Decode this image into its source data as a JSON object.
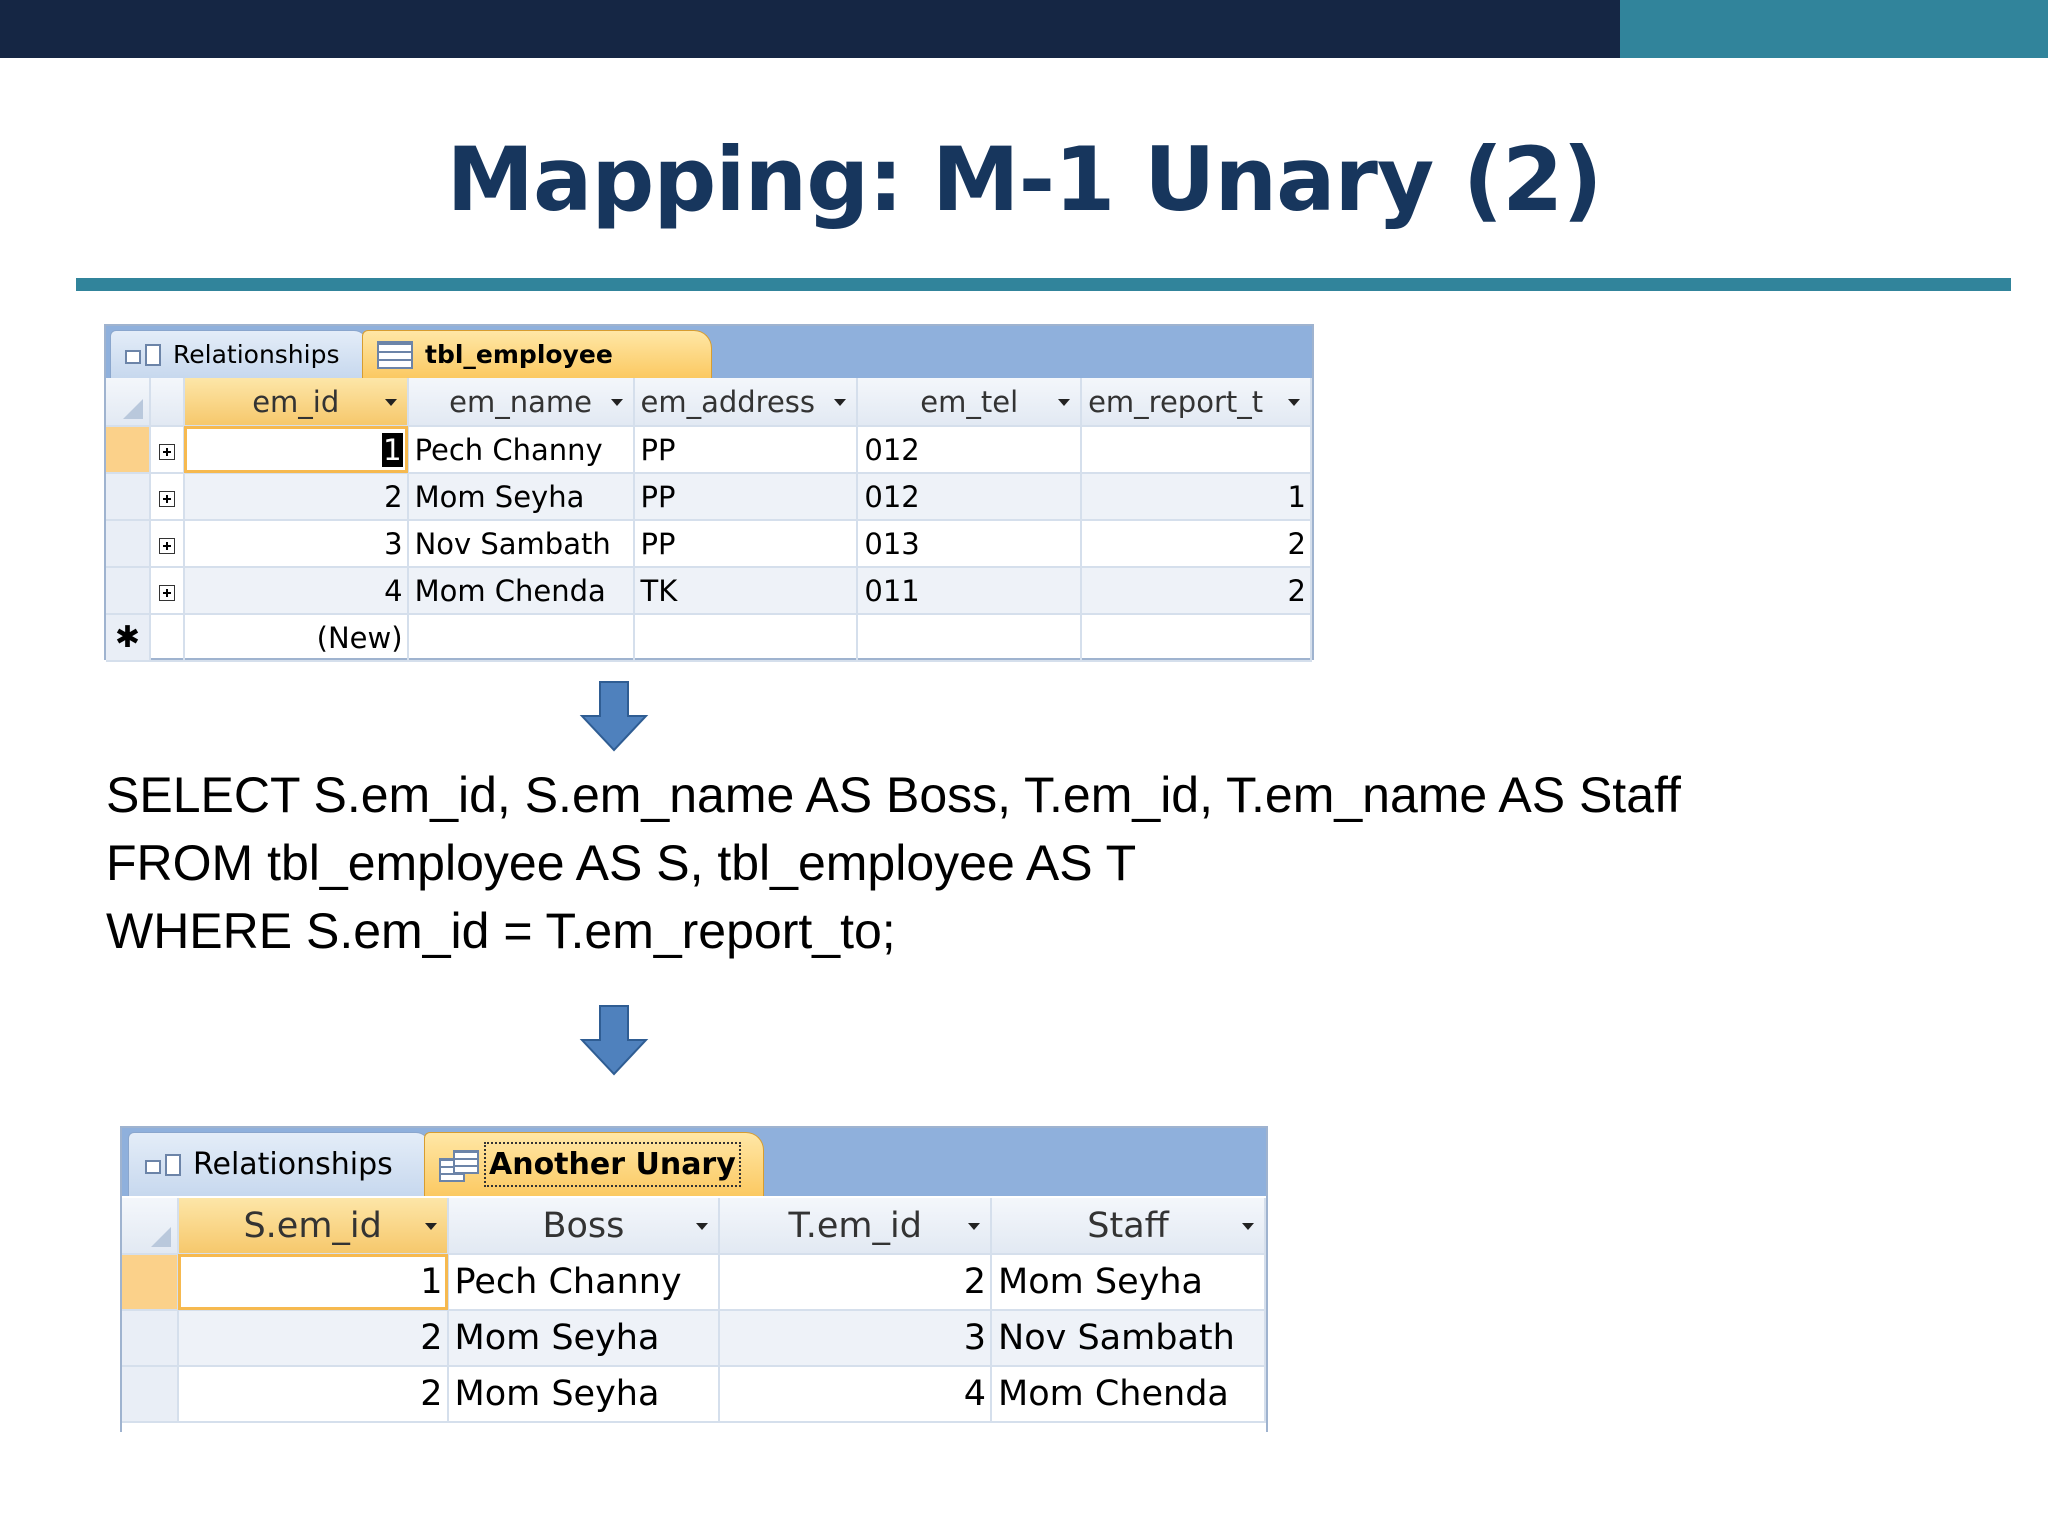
{
  "slide": {
    "title": "Mapping: M-1 Unary (2)",
    "accent_dark": "#152644",
    "accent_teal": "#31849b"
  },
  "table1": {
    "tabs": [
      {
        "label": "Relationships",
        "icon": "relationships-icon",
        "active": false
      },
      {
        "label": "tbl_employee",
        "icon": "table-icon",
        "active": true
      }
    ],
    "columns": [
      "em_id",
      "em_name",
      "em_address",
      "em_tel",
      "em_report_t"
    ],
    "rows": [
      {
        "em_id": "1",
        "em_name": "Pech Channy",
        "em_address": "PP",
        "em_tel": "012",
        "em_report_to": ""
      },
      {
        "em_id": "2",
        "em_name": "Mom Seyha",
        "em_address": "PP",
        "em_tel": "012",
        "em_report_to": "1"
      },
      {
        "em_id": "3",
        "em_name": "Nov Sambath",
        "em_address": "PP",
        "em_tel": "013",
        "em_report_to": "2"
      },
      {
        "em_id": "4",
        "em_name": "Mom Chenda",
        "em_address": "TK",
        "em_tel": "011",
        "em_report_to": "2"
      }
    ],
    "new_row_label": "(New)",
    "new_row_marker": "✱"
  },
  "sql": {
    "line1": "SELECT S.em_id, S.em_name AS Boss, T.em_id, T.em_name AS Staff",
    "line2": "FROM tbl_employee AS S, tbl_employee AS T",
    "line3": "WHERE S.em_id = T.em_report_to;"
  },
  "table2": {
    "tabs": [
      {
        "label": "Relationships",
        "icon": "relationships-icon",
        "active": false
      },
      {
        "label": "Another Unary",
        "icon": "query-icon",
        "active": true
      }
    ],
    "columns": [
      "S.em_id",
      "Boss",
      "T.em_id",
      "Staff"
    ],
    "rows": [
      {
        "s_id": "1",
        "boss": "Pech Channy",
        "t_id": "2",
        "staff": "Mom Seyha"
      },
      {
        "s_id": "2",
        "boss": "Mom Seyha",
        "t_id": "3",
        "staff": "Nov Sambath"
      },
      {
        "s_id": "2",
        "boss": "Mom Seyha",
        "t_id": "4",
        "staff": "Mom Chenda"
      }
    ]
  }
}
